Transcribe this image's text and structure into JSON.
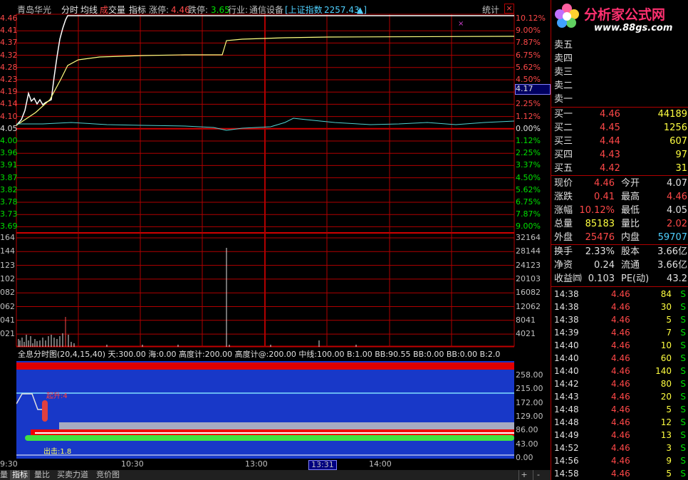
{
  "header": {
    "stock_name": "青岛华光",
    "tab_intraday": "分时",
    "tab_avg_line": "均线",
    "tab_volume_prefix": "成",
    "tab_volume": "交量",
    "tab_indicator": "指标",
    "limit_up_label": "涨停:",
    "limit_up_value": "4.46",
    "limit_down_label": "跌停:",
    "limit_down_value": "3.65",
    "industry_label": "行业:",
    "industry_value": "通信设备",
    "index_name": "[上证指数",
    "index_value": "2257.43",
    "index_arrow": "▲]",
    "stats_button": "统计",
    "close_symbol": "×"
  },
  "price_axis_left": [
    "4.46",
    "4.41",
    "4.37",
    "4.32",
    "4.28",
    "4.23",
    "4.19",
    "4.14",
    "4.10",
    "4.05",
    "4.00",
    "3.96",
    "3.91",
    "3.87",
    "3.82",
    "3.78",
    "3.73",
    "3.69"
  ],
  "price_axis_right": [
    "10.12%",
    "9.00%",
    "7.87%",
    "6.75%",
    "5.62%",
    "4.50%",
    "3.37%",
    "2.25%",
    "1.12%",
    "0.00%",
    "1.12%",
    "2.25%",
    "3.37%",
    "4.50%",
    "5.62%",
    "6.75%",
    "7.87%",
    "9.00%"
  ],
  "cursor_price": "4.17",
  "volume_axis_left": [
    "164",
    "144",
    "123",
    "102",
    "082",
    "062",
    "041",
    "021"
  ],
  "volume_axis_right": [
    "32164",
    "28144",
    "24123",
    "20103",
    "16082",
    "12062",
    "8041",
    "4021"
  ],
  "indicator_header": "全息分时图(20,4,15,40) 天:300.00 海:0.00 高度计:200.00 高度计@:200.00 中线:100.00 B:1.00 BB:90.55 BB:0.00 BB:0.00 B:2.0",
  "indicator_axis": [
    "258.00",
    "215.00",
    "172.00",
    "129.00",
    "86.00",
    "43.00",
    "0.00"
  ],
  "indicator_labels": {
    "top": "起升:4",
    "bottom": "出击:1.8"
  },
  "time_axis": [
    "9:30",
    "10:30",
    "13:00",
    "13:31",
    "14:00"
  ],
  "bottom_tabs": [
    "量",
    "指标",
    "量比",
    "买卖力道",
    "竞价图"
  ],
  "bottom_controls": [
    "+",
    "-"
  ],
  "logo": {
    "text": "分析家公式网",
    "url_text": "www.88gs.com"
  },
  "sell_orders": [
    {
      "label": "卖五",
      "price": "",
      "vol": ""
    },
    {
      "label": "卖四",
      "price": "",
      "vol": ""
    },
    {
      "label": "卖三",
      "price": "",
      "vol": ""
    },
    {
      "label": "卖二",
      "price": "",
      "vol": ""
    },
    {
      "label": "卖一",
      "price": "",
      "vol": ""
    }
  ],
  "buy_orders": [
    {
      "label": "买一",
      "price": "4.46",
      "vol": "44189"
    },
    {
      "label": "买二",
      "price": "4.45",
      "vol": "1256"
    },
    {
      "label": "买三",
      "price": "4.44",
      "vol": "607"
    },
    {
      "label": "买四",
      "price": "4.43",
      "vol": "97"
    },
    {
      "label": "买五",
      "price": "4.42",
      "vol": "31"
    }
  ],
  "quote": [
    {
      "l1": "现价",
      "v1": "4.46",
      "l2": "今开",
      "v2": "4.07"
    },
    {
      "l1": "涨跌",
      "v1": "0.41",
      "l2": "最高",
      "v2": "4.46"
    },
    {
      "l1": "涨幅",
      "v1": "10.12%",
      "l2": "最低",
      "v2": "4.05"
    },
    {
      "l1": "总量",
      "v1": "85183",
      "l2": "量比",
      "v2": "2.02"
    },
    {
      "l1": "外盘",
      "v1": "25476",
      "l2": "内盘",
      "v2": "59707"
    }
  ],
  "stats": [
    {
      "l1": "换手",
      "v1": "2.33%",
      "l2": "股本",
      "v2": "3.66亿"
    },
    {
      "l1": "净资",
      "v1": "0.24",
      "l2": "流通",
      "v2": "3.66亿"
    },
    {
      "l1": "收益㈣",
      "v1": "0.103",
      "l2": "PE(动)",
      "v2": "43.2"
    }
  ],
  "ticks": [
    {
      "time": "14:38",
      "price": "4.46",
      "vol": "84",
      "side": "S"
    },
    {
      "time": "14:38",
      "price": "4.46",
      "vol": "30",
      "side": "S"
    },
    {
      "time": "14:38",
      "price": "4.46",
      "vol": "5",
      "side": "S"
    },
    {
      "time": "14:39",
      "price": "4.46",
      "vol": "7",
      "side": "S"
    },
    {
      "time": "14:40",
      "price": "4.46",
      "vol": "10",
      "side": "S"
    },
    {
      "time": "14:40",
      "price": "4.46",
      "vol": "60",
      "side": "S"
    },
    {
      "time": "14:40",
      "price": "4.46",
      "vol": "140",
      "side": "S"
    },
    {
      "time": "14:42",
      "price": "4.46",
      "vol": "80",
      "side": "S"
    },
    {
      "time": "14:43",
      "price": "4.46",
      "vol": "20",
      "side": "S"
    },
    {
      "time": "14:48",
      "price": "4.46",
      "vol": "5",
      "side": "S"
    },
    {
      "time": "14:48",
      "price": "4.46",
      "vol": "12",
      "side": "S"
    },
    {
      "time": "14:49",
      "price": "4.46",
      "vol": "13",
      "side": "S"
    },
    {
      "time": "14:52",
      "price": "4.46",
      "vol": "3",
      "side": "S"
    },
    {
      "time": "14:56",
      "price": "4.46",
      "vol": "9",
      "side": "S"
    },
    {
      "time": "14:58",
      "price": "4.46",
      "vol": "5",
      "side": "S"
    }
  ],
  "colors": {
    "grid": "#b00000",
    "price_line": "#ffffff",
    "avg_line": "#ffff80",
    "index_line": "#4fd0d0",
    "up": "#ff4848",
    "down": "#00e000",
    "indicator_bg": "#1838c8"
  }
}
